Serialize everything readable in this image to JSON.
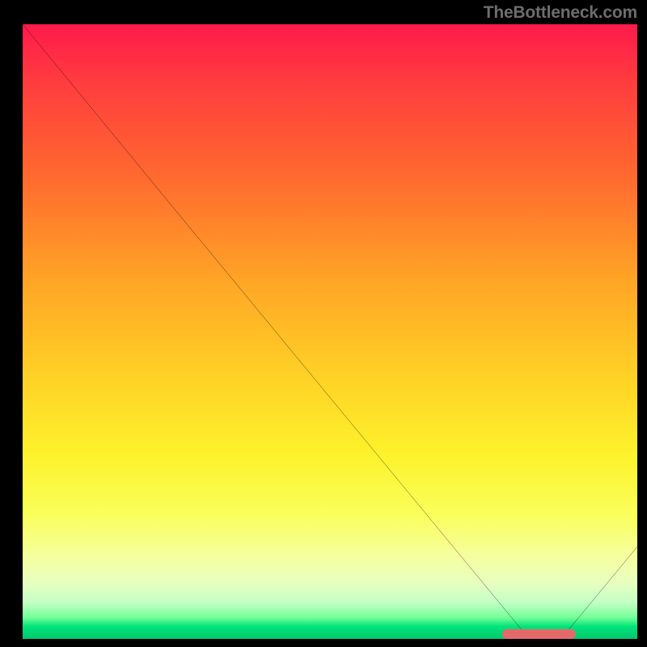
{
  "attribution": "TheBottleneck.com",
  "chart_data": {
    "type": "line",
    "title": "",
    "xlabel": "",
    "ylabel": "",
    "xlim": [
      0,
      100
    ],
    "ylim": [
      0,
      100
    ],
    "series": [
      {
        "name": "curve",
        "points": [
          {
            "x": 0,
            "y": 100
          },
          {
            "x": 23,
            "y": 72
          },
          {
            "x": 82,
            "y": 0.5
          },
          {
            "x": 88,
            "y": 0.5
          },
          {
            "x": 100,
            "y": 15
          }
        ]
      }
    ],
    "highlight_segment": {
      "x_start": 78,
      "x_end": 90,
      "y": 0.8
    },
    "gradient_stops": [
      {
        "pct": 0,
        "color": "#ff1a4b"
      },
      {
        "pct": 10,
        "color": "#ff3e3e"
      },
      {
        "pct": 25,
        "color": "#ff6a2f"
      },
      {
        "pct": 42,
        "color": "#ffa626"
      },
      {
        "pct": 58,
        "color": "#ffd326"
      },
      {
        "pct": 70,
        "color": "#fdf22b"
      },
      {
        "pct": 80,
        "color": "#f9ff5c"
      },
      {
        "pct": 87,
        "color": "#f5ffa3"
      },
      {
        "pct": 91,
        "color": "#e6ffc0"
      },
      {
        "pct": 94,
        "color": "#c5ffc5"
      },
      {
        "pct": 96.5,
        "color": "#76ff99"
      },
      {
        "pct": 98,
        "color": "#00e37a"
      },
      {
        "pct": 100,
        "color": "#00c86e"
      }
    ]
  }
}
